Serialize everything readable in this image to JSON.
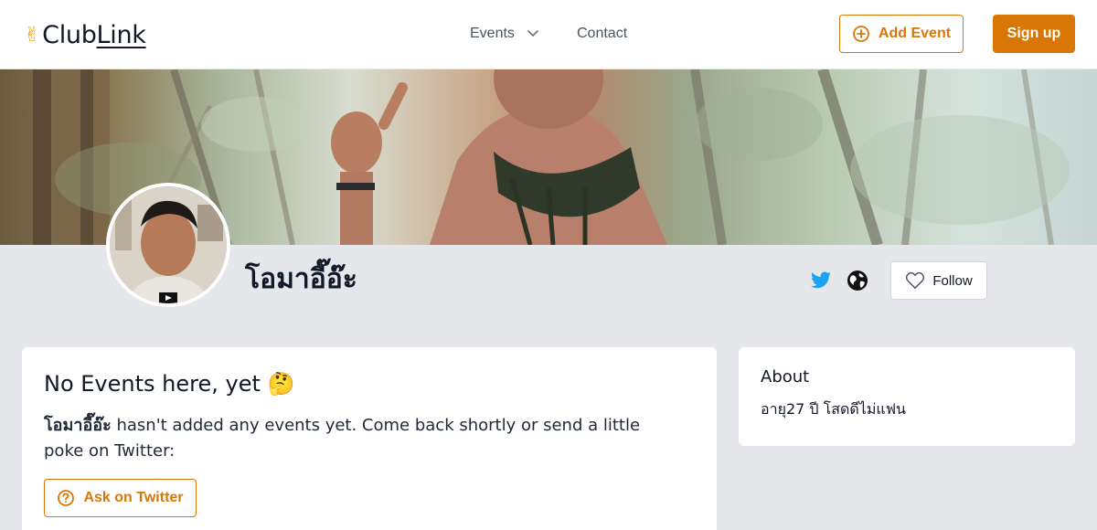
{
  "header": {
    "logo_club": "ClubLink",
    "logo_part1": "Club",
    "logo_part2": "Link",
    "nav_events": "Events",
    "nav_contact": "Contact",
    "add_event_label": "Add Event",
    "signup_label": "Sign up"
  },
  "profile": {
    "name": "โอมาอี๊อ๊ะ",
    "follow_label": "Follow",
    "icons": [
      "twitter-icon",
      "globe-icon",
      "heart-icon"
    ]
  },
  "events_card": {
    "title": "No Events here, yet",
    "emoji": "🤔",
    "owner_name": "โอมาอี๊อ๊ะ",
    "body": " hasn't added any events yet. Come back shortly or send a little poke on Twitter:",
    "ask_label": "Ask on Twitter"
  },
  "about_card": {
    "title": "About",
    "text": "อายุ27 ปี โสดดีไม่แฟน"
  },
  "colors": {
    "accent": "#d97706",
    "twitter": "#1da1f2",
    "background": "#e5e7eb"
  }
}
